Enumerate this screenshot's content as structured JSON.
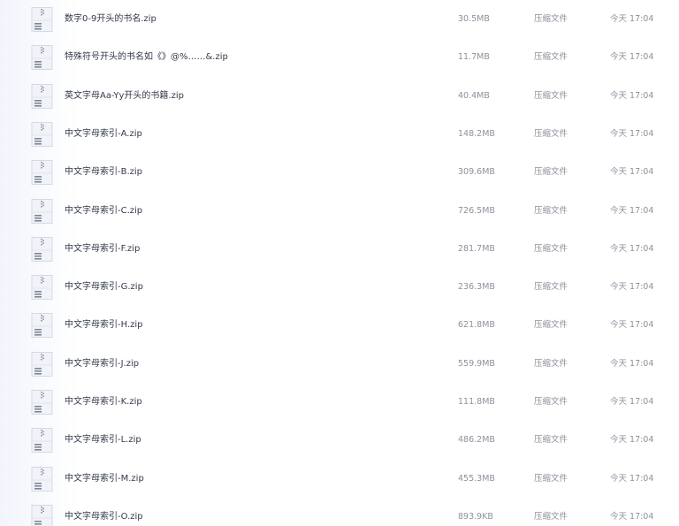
{
  "icon": "zip-file-icon",
  "colors": {
    "row_name_text": "#333a48",
    "meta_text": "#8c919b",
    "icon_body": "#f1f3f8",
    "icon_stroke": "#d3d9e5",
    "icon_lines": "#7d8797"
  },
  "files": [
    {
      "name": "数字0-9开头的书名.zip",
      "size": "30.5MB",
      "type": "压缩文件",
      "time": "今天 17:04"
    },
    {
      "name": "特殊符号开头的书名如《》@%……&.zip",
      "size": "11.7MB",
      "type": "压缩文件",
      "time": "今天 17:04"
    },
    {
      "name": "英文字母Aa-Yy开头的书籍.zip",
      "size": "40.4MB",
      "type": "压缩文件",
      "time": "今天 17:04"
    },
    {
      "name": "中文字母索引-A.zip",
      "size": "148.2MB",
      "type": "压缩文件",
      "time": "今天 17:04"
    },
    {
      "name": "中文字母索引-B.zip",
      "size": "309.6MB",
      "type": "压缩文件",
      "time": "今天 17:04"
    },
    {
      "name": "中文字母索引-C.zip",
      "size": "726.5MB",
      "type": "压缩文件",
      "time": "今天 17:04"
    },
    {
      "name": "中文字母索引-F.zip",
      "size": "281.7MB",
      "type": "压缩文件",
      "time": "今天 17:04"
    },
    {
      "name": "中文字母索引-G.zip",
      "size": "236.3MB",
      "type": "压缩文件",
      "time": "今天 17:04"
    },
    {
      "name": "中文字母索引-H.zip",
      "size": "621.8MB",
      "type": "压缩文件",
      "time": "今天 17:04"
    },
    {
      "name": "中文字母索引-J.zip",
      "size": "559.9MB",
      "type": "压缩文件",
      "time": "今天 17:04"
    },
    {
      "name": "中文字母索引-K.zip",
      "size": "111.8MB",
      "type": "压缩文件",
      "time": "今天 17:04"
    },
    {
      "name": "中文字母索引-L.zip",
      "size": "486.2MB",
      "type": "压缩文件",
      "time": "今天 17:04"
    },
    {
      "name": "中文字母索引-M.zip",
      "size": "455.3MB",
      "type": "压缩文件",
      "time": "今天 17:04"
    },
    {
      "name": "中文字母索引-O.zip",
      "size": "893.9KB",
      "type": "压缩文件",
      "time": "今天 17:04"
    }
  ]
}
